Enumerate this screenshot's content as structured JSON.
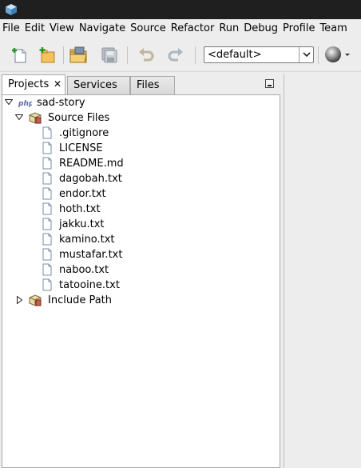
{
  "menubar": {
    "items": [
      "File",
      "Edit",
      "View",
      "Navigate",
      "Source",
      "Refactor",
      "Run",
      "Debug",
      "Profile",
      "Team"
    ]
  },
  "toolbar": {
    "buttons": [
      "new-file",
      "new-project",
      "open-project",
      "save-all",
      "undo",
      "redo"
    ],
    "config_value": "<default>"
  },
  "tabs": {
    "projects": "Projects",
    "services": "Services",
    "files": "Files",
    "close_glyph": "✕"
  },
  "tree": {
    "project": "sad-story",
    "source_files": "Source Files",
    "files": [
      ".gitignore",
      "LICENSE",
      "README.md",
      "dagobah.txt",
      "endor.txt",
      "hoth.txt",
      "jakku.txt",
      "kamino.txt",
      "mustafar.txt",
      "naboo.txt",
      "tatooine.txt"
    ],
    "include_path": "Include Path"
  },
  "colors": {
    "titlebar": "#1f1f1f",
    "chrome": "#ededed",
    "panel": "#ffffff",
    "border": "#a9a9a9"
  }
}
